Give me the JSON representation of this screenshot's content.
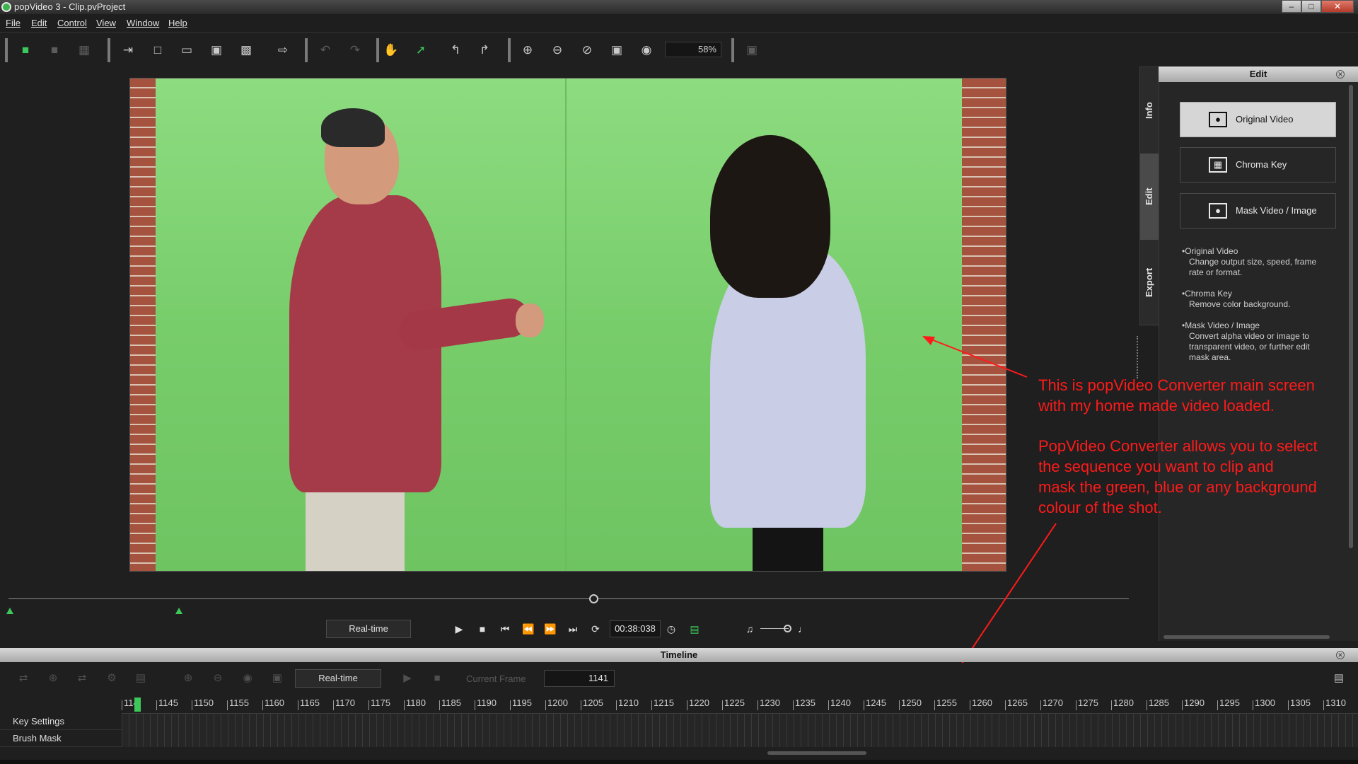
{
  "window": {
    "title": "popVideo 3 - Clip.pvProject",
    "controls": {
      "minimize": "–",
      "maximize": "□",
      "close": "✕"
    }
  },
  "menu": [
    "File",
    "Edit",
    "Control",
    "View",
    "Window",
    "Help"
  ],
  "toolbar": {
    "zoom": "58%"
  },
  "transport": {
    "mode": "Real-time",
    "timecode": "00:38:038"
  },
  "side_tabs": [
    "Info",
    "Edit",
    "Export"
  ],
  "edit_panel": {
    "title": "Edit",
    "options": [
      {
        "label": "Original Video",
        "icon": "person-icon"
      },
      {
        "label": "Chroma Key",
        "icon": "checker-icon"
      },
      {
        "label": "Mask Video / Image",
        "icon": "mask-icon"
      }
    ],
    "descriptions": [
      {
        "title": "Original Video",
        "lines": [
          "Change output size, speed, frame",
          "rate or format."
        ]
      },
      {
        "title": "Chroma Key",
        "lines": [
          "Remove color background."
        ]
      },
      {
        "title": "Mask Video / Image",
        "lines": [
          "Convert alpha video or image to",
          "transparent video, or further edit",
          "mask area."
        ]
      }
    ]
  },
  "annotations": {
    "note1": [
      "This is popVideo Converter main screen",
      "with my home made video loaded."
    ],
    "note2": [
      "PopVideo Converter allows you to select",
      "the sequence you want to clip and",
      "mask the green, blue or any background",
      "colour of the shot."
    ]
  },
  "timeline": {
    "title": "Timeline",
    "mode": "Real-time",
    "current_frame_label": "Current Frame",
    "current_frame": "1141",
    "ruler_start_label": "114",
    "ruler": [
      "1145",
      "1150",
      "1155",
      "1160",
      "1165",
      "1170",
      "1175",
      "1180",
      "1185",
      "1190",
      "1195",
      "1200",
      "1205",
      "1210",
      "1215",
      "1220",
      "1225",
      "1230",
      "1235",
      "1240",
      "1245",
      "1250",
      "1255",
      "1260",
      "1265",
      "1270",
      "1275",
      "1280",
      "1285",
      "1290",
      "1295",
      "1300",
      "1305",
      "1310"
    ],
    "tracks": [
      "Key Settings",
      "Brush Mask"
    ]
  },
  "colors": {
    "accent_green": "#3cc85a",
    "annotation_red": "#ff1a1a"
  }
}
